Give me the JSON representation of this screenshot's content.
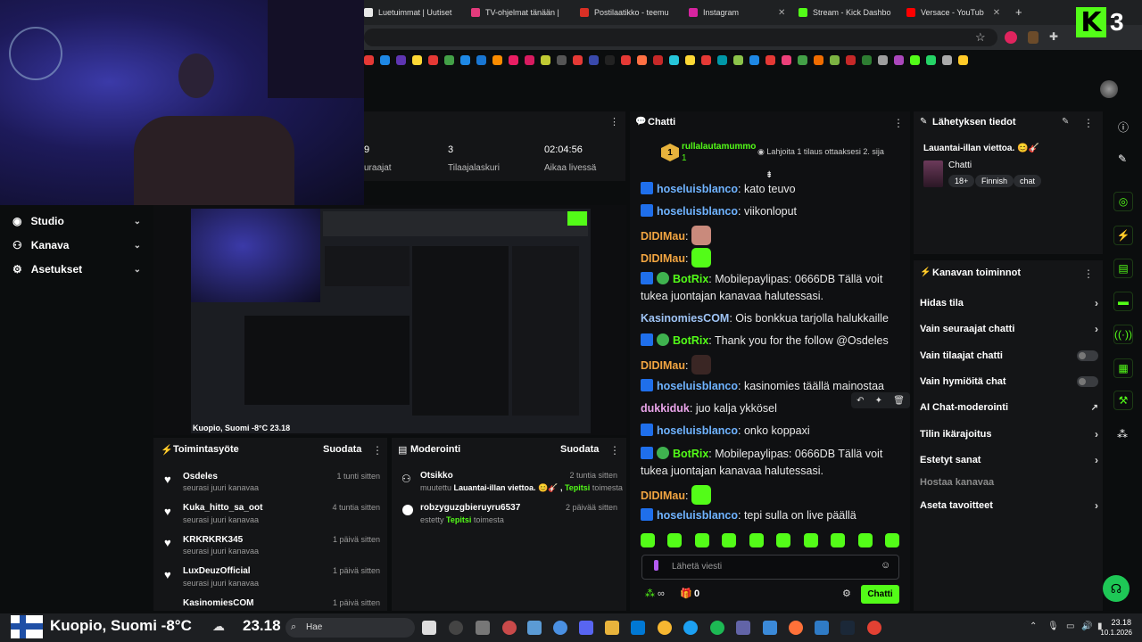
{
  "browser": {
    "tabs": [
      {
        "label": "Luetuimmat | Uutiset",
        "color": "#e8e8e8"
      },
      {
        "label": "TV-ohjelmat tänään |",
        "color": "#e23b7c"
      },
      {
        "label": "Postilaatikko - teemu",
        "color": "#d93025"
      },
      {
        "label": "Instagram",
        "color": "#d6249f"
      },
      {
        "label": "Stream - Kick Dashbo",
        "color": "#53fc18"
      },
      {
        "label": "Versace - YouTub",
        "color": "#ff0000"
      }
    ],
    "new_tab": "+"
  },
  "stats": [
    {
      "value": "9",
      "label": "uraajat"
    },
    {
      "value": "3",
      "label": "Tilaajalaskuri"
    },
    {
      "value": "02:04:56",
      "label": "Aikaa livessä"
    }
  ],
  "sidebar": {
    "items": [
      {
        "label": "Studio"
      },
      {
        "label": "Kanava"
      },
      {
        "label": "Asetukset"
      }
    ]
  },
  "activity": {
    "title": "Toimintasyöte",
    "filter": "Suodata",
    "items": [
      {
        "name": "Osdeles",
        "sub": "seurasi juuri kanavaa",
        "time": "1 tunti sitten"
      },
      {
        "name": "Kuka_hitto_sa_oot",
        "sub": "seurasi juuri kanavaa",
        "time": "4 tuntia sitten"
      },
      {
        "name": "KRKRKRK345",
        "sub": "seurasi juuri kanavaa",
        "time": "1 päivä sitten"
      },
      {
        "name": "LuxDeuzOfficial",
        "sub": "seurasi juuri kanavaa",
        "time": "1 päivä sitten"
      },
      {
        "name": "KasinomiesCOM",
        "sub": "",
        "time": "1 päivä sitten"
      }
    ]
  },
  "moderation": {
    "title": "Moderointi",
    "filter": "Suodata",
    "items": [
      {
        "name": "Otsikko",
        "sub_prefix": "muutettu ",
        "sub_bold": "Lauantai-illan viettoa. 😊🎸 , ",
        "sub_user": "Tepitsi",
        "sub_suffix": " toimesta",
        "time": "2 tuntia sitten"
      },
      {
        "name": "robzyguzgbieruyru6537",
        "sub_prefix": "estetty ",
        "sub_bold": "",
        "sub_user": "Tepitsi",
        "sub_suffix": " toimesta",
        "time": "2 päivää sitten"
      }
    ]
  },
  "preview": {
    "caption": "Kuopio, Suomi -8°C   23.18"
  },
  "chat": {
    "title": "Chatti",
    "pinned_user": "rullalautamummo",
    "pinned_count": "1",
    "pinned_text": "Lahjoita 1 tilaus ottaaksesi 2. sija",
    "messages": [
      {
        "user": "hoseluisblanco",
        "color": "#6fb3ff",
        "badge": "blue",
        "text": "kato teuvo"
      },
      {
        "user": "hoseluisblanco",
        "color": "#6fb3ff",
        "badge": "blue",
        "text": "viikonloput"
      },
      {
        "user": "DIDIMau",
        "color": "#f2a541",
        "badge": "",
        "text": "",
        "emote": "#c98a7c"
      },
      {
        "user": "DIDIMau",
        "color": "#f2a541",
        "badge": "",
        "text": "",
        "emote": "#53fc18"
      },
      {
        "user": "BotRix",
        "color": "#53fc18",
        "badge": "bot",
        "text": "Mobilepaylipas: 0666DB Tällä voit tukea juontajan kanavaa halutessasi."
      },
      {
        "user": "KasinomiesCOM",
        "color": "#9fc4f5",
        "badge": "",
        "text": "Ois bonkkua tarjolla halukkaille"
      },
      {
        "user": "BotRix",
        "color": "#53fc18",
        "badge": "bot",
        "text": "Thank you for the follow @Osdeles"
      },
      {
        "user": "DIDIMau",
        "color": "#f2a541",
        "badge": "",
        "text": "",
        "emote": "#3a2624"
      },
      {
        "user": "hoseluisblanco",
        "color": "#6fb3ff",
        "badge": "blue",
        "text": "kasinomies täällä mainostaa"
      },
      {
        "user": "dukkiduk",
        "color": "#e9a4e9",
        "badge": "",
        "text": "juo kalja ykkösel"
      },
      {
        "user": "hoseluisblanco",
        "color": "#6fb3ff",
        "badge": "blue",
        "text": "onko koppaxi"
      },
      {
        "user": "BotRix",
        "color": "#53fc18",
        "badge": "bot",
        "text": "Mobilepaylipas: 0666DB Tällä voit tukea juontajan kanavaa halutessasi."
      },
      {
        "user": "DIDIMau",
        "color": "#f2a541",
        "badge": "",
        "text": "",
        "emote": "#53fc18"
      },
      {
        "user": "hoseluisblanco",
        "color": "#6fb3ff",
        "badge": "blue",
        "text": "tepi sulla on live päällä"
      }
    ],
    "input_placeholder": "Lähetä viesti",
    "count_symbol": "∞",
    "gift_count": "0",
    "send_label": "Chatti"
  },
  "info": {
    "title": "Lähetyksen tiedot",
    "stream_title": "Lauantai-illan viettoa. 😊🎸",
    "category": "Chatti",
    "tags": [
      "18+",
      "Finnish",
      "chat"
    ]
  },
  "channel": {
    "title": "Kanavan toiminnot",
    "items": [
      {
        "label": "Hidas tila",
        "control": "arrow"
      },
      {
        "label": "Vain seuraajat chatti",
        "control": "arrow"
      },
      {
        "label": "Vain tilaajat chatti",
        "control": "toggle"
      },
      {
        "label": "Vain hymiöitä chat",
        "control": "toggle"
      },
      {
        "label": "AI Chat-moderointi",
        "control": "ext"
      },
      {
        "label": "Tilin ikärajoitus",
        "control": "arrow"
      },
      {
        "label": "Estetyt sanat",
        "control": "arrow"
      },
      {
        "label": "Hostaa kanavaa",
        "control": "none"
      },
      {
        "label": "Aseta tavoitteet",
        "control": "arrow"
      }
    ]
  },
  "taskbar": {
    "location": "Kuopio, Suomi",
    "temp": "-8°C",
    "time_big": "23.18",
    "search_placeholder": "Hae",
    "clock_time": "23.18",
    "clock_date": "10.1.2026"
  },
  "colors": {
    "accent": "#53fc18",
    "background": "#0b0d0e",
    "panel": "#141517"
  }
}
